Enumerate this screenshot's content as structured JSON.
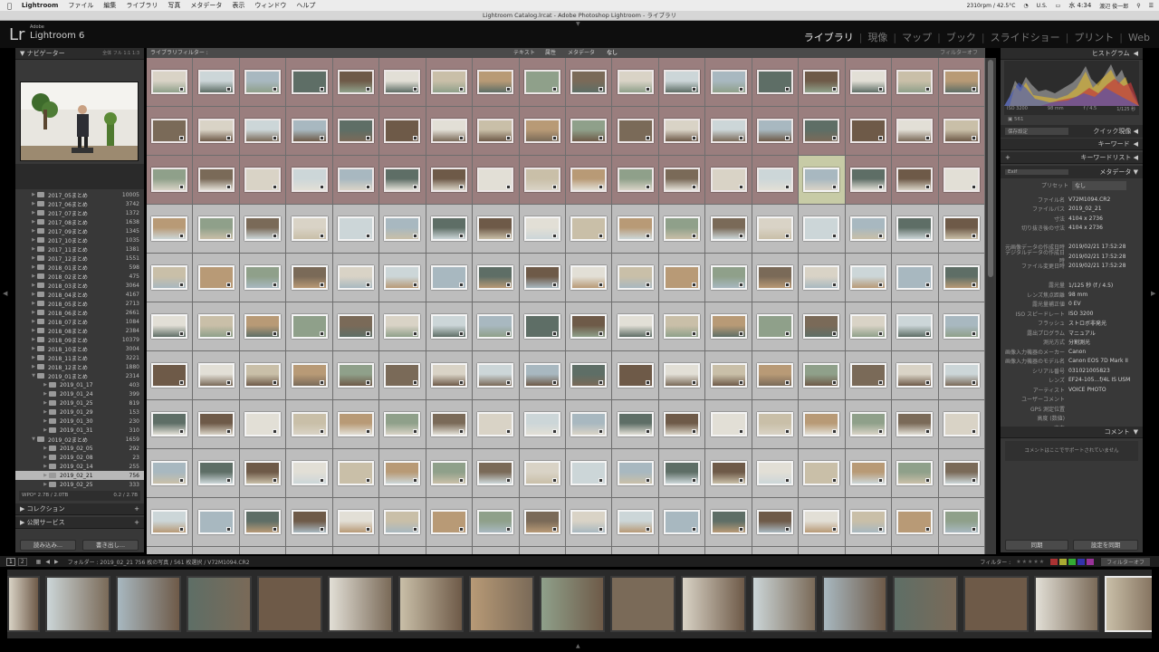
{
  "menubar": {
    "apple": "",
    "app": "Lightroom",
    "items": [
      "ファイル",
      "編集",
      "ライブラリ",
      "写真",
      "メタデータ",
      "表示",
      "ウィンドウ",
      "ヘルプ"
    ],
    "status_fan": "2310rpm / 42.5°C",
    "status_region": "U.S.",
    "status_time": "水 4:34",
    "status_user": "渡辺 俊一郎"
  },
  "window_title": "Lightroom Catalog.lrcat - Adobe Photoshop Lightroom - ライブラリ",
  "identity": {
    "logo": "Lr",
    "brand_small": "Adobe",
    "brand": "Lightroom 6"
  },
  "modules": [
    "ライブラリ",
    "現像",
    "マップ",
    "ブック",
    "スライドショー",
    "プリント",
    "Web"
  ],
  "active_module": "ライブラリ",
  "left_panel": {
    "navigator": {
      "title": "ナビゲーター",
      "zoom_options": [
        "全体",
        "フル",
        "1:1",
        "1:3"
      ]
    },
    "folders": [
      {
        "name": "2017_05まとめ",
        "count": "10005",
        "level": 1
      },
      {
        "name": "2017_06まとめ",
        "count": "3742",
        "level": 1
      },
      {
        "name": "2017_07まとめ",
        "count": "1372",
        "level": 1
      },
      {
        "name": "2017_08まとめ",
        "count": "1638",
        "level": 1
      },
      {
        "name": "2017_09まとめ",
        "count": "1345",
        "level": 1
      },
      {
        "name": "2017_10まとめ",
        "count": "1035",
        "level": 1
      },
      {
        "name": "2017_11まとめ",
        "count": "1381",
        "level": 1
      },
      {
        "name": "2017_12まとめ",
        "count": "1551",
        "level": 1
      },
      {
        "name": "2018_01まとめ",
        "count": "598",
        "level": 1
      },
      {
        "name": "2018_02まとめ",
        "count": "475",
        "level": 1
      },
      {
        "name": "2018_03まとめ",
        "count": "3064",
        "level": 1
      },
      {
        "name": "2018_04まとめ",
        "count": "4167",
        "level": 1
      },
      {
        "name": "2018_05まとめ",
        "count": "2713",
        "level": 1
      },
      {
        "name": "2018_06まとめ",
        "count": "2661",
        "level": 1
      },
      {
        "name": "2018_07まとめ",
        "count": "1084",
        "level": 1
      },
      {
        "name": "2018_08まとめ",
        "count": "2384",
        "level": 1
      },
      {
        "name": "2018_09まとめ",
        "count": "10379",
        "level": 1
      },
      {
        "name": "2018_10まとめ",
        "count": "3004",
        "level": 1
      },
      {
        "name": "2018_11まとめ",
        "count": "3221",
        "level": 1
      },
      {
        "name": "2018_12まとめ",
        "count": "1880",
        "level": 1
      },
      {
        "name": "2019_01まとめ",
        "count": "2314",
        "level": 1,
        "open": true
      },
      {
        "name": "2019_01_17",
        "count": "403",
        "level": 2
      },
      {
        "name": "2019_01_24",
        "count": "399",
        "level": 2
      },
      {
        "name": "2019_01_25",
        "count": "819",
        "level": 2
      },
      {
        "name": "2019_01_29",
        "count": "153",
        "level": 2
      },
      {
        "name": "2019_01_30",
        "count": "230",
        "level": 2
      },
      {
        "name": "2019_01_31",
        "count": "310",
        "level": 2
      },
      {
        "name": "2019_02まとめ",
        "count": "1659",
        "level": 1,
        "open": true
      },
      {
        "name": "2019_02_05",
        "count": "292",
        "level": 2
      },
      {
        "name": "2019_02_08",
        "count": "23",
        "level": 2
      },
      {
        "name": "2019_02_14",
        "count": "255",
        "level": 2
      },
      {
        "name": "2019_02_21",
        "count": "756",
        "level": 2,
        "selected": true
      },
      {
        "name": "2019_02_25",
        "count": "333",
        "level": 2
      }
    ],
    "volume": {
      "name": "WPO* 2.7B / 2.0TB",
      "usage": "0.2 / 2.7B"
    },
    "collections": "コレクション",
    "publish": "公開サービス",
    "import_btn": "読み込み...",
    "export_btn": "書き出し..."
  },
  "filter_bar": {
    "label": "ライブラリフィルター :",
    "options": [
      "テキスト",
      "属性",
      "メタデータ",
      "なし"
    ],
    "right": "フィルターオフ"
  },
  "right_panel": {
    "histogram": {
      "title": "ヒストグラム",
      "iso": "ISO 3200",
      "focal": "98 mm",
      "aperture": "f / 4.5",
      "shutter": "1/125 秒",
      "count": "561"
    },
    "quick_develop": {
      "preset": "保存設定",
      "title": "クイック現像"
    },
    "keywords": "キーワード",
    "keyword_list": "キーワードリスト",
    "metadata": {
      "title": "メタデータ",
      "view": "Exif",
      "preset_label": "プリセット",
      "preset_value": "なし",
      "rows": [
        {
          "k": "ファイル名",
          "v": "V72M1094.CR2"
        },
        {
          "k": "ファイルパス",
          "v": "2019_02_21"
        },
        {
          "k": "寸法",
          "v": "4104 x 2736"
        },
        {
          "k": "切り抜き後の寸法",
          "v": "4104 x 2736"
        },
        {
          "k": "",
          "v": ""
        },
        {
          "k": "元画像データの作成日時",
          "v": "2019/02/21 17:52:28"
        },
        {
          "k": "デジタルデータの作成日時",
          "v": "2019/02/21 17:52:28"
        },
        {
          "k": "ファイル変更日時",
          "v": "2019/02/21 17:52:28"
        },
        {
          "k": "",
          "v": ""
        },
        {
          "k": "露光量",
          "v": "1/125 秒 (f / 4.5)"
        },
        {
          "k": "レンズ焦点距離",
          "v": "98 mm"
        },
        {
          "k": "露光量補正値",
          "v": "0 EV"
        },
        {
          "k": "ISO スピードレート",
          "v": "ISO 3200"
        },
        {
          "k": "フラッシュ",
          "v": "ストロボ非発光"
        },
        {
          "k": "露出プログラム",
          "v": "マニュアル"
        },
        {
          "k": "測光方式",
          "v": "分割測光"
        },
        {
          "k": "画像入力機器のメーカー",
          "v": "Canon"
        },
        {
          "k": "画像入力機器のモデル名",
          "v": "Canon EOS 7D Mark II"
        },
        {
          "k": "シリアル番号",
          "v": "031021005823"
        },
        {
          "k": "レンズ",
          "v": "EF24-105...f/4L IS USM"
        },
        {
          "k": "アーティスト",
          "v": "VOICE PHOTO"
        },
        {
          "k": "ユーザーコメント",
          "v": ""
        },
        {
          "k": "GPS 測定位置",
          "v": ""
        },
        {
          "k": "高度 (数値)",
          "v": ""
        },
        {
          "k": "方向",
          "v": ""
        }
      ]
    },
    "comments": {
      "title": "コメント",
      "note": "コメントはここでサポートされていません"
    },
    "sync_btn": "同期",
    "sync_settings_btn": "設定を同期"
  },
  "status": {
    "page1": "1",
    "page2": "2",
    "path": "フォルダー : 2019_02_21   756 枚の写真 / 561 枚選択 / V72M1094.CR2",
    "filter_label": "フィルター :",
    "filter_off": "フィルターオフ"
  },
  "colors": {
    "pick_cell": "#9a7e7e",
    "grey_cell": "#bdbdbd",
    "selected_cell": "#c7cba6",
    "panel_bg": "#383838"
  }
}
